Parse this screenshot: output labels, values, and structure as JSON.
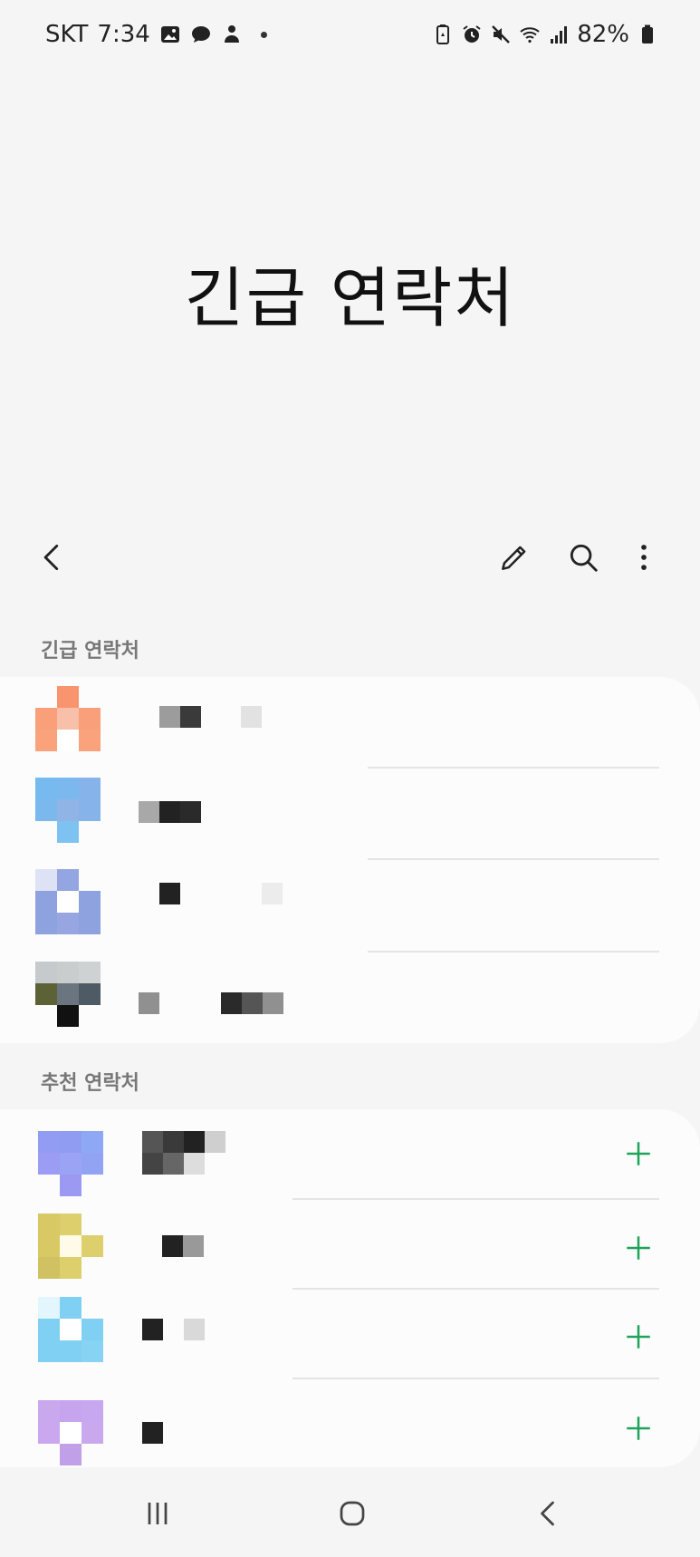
{
  "status_bar": {
    "carrier": "SKT",
    "time": "7:34",
    "battery": "82%",
    "left_icons": [
      "gallery-icon",
      "chat-bubble-icon",
      "assistant-icon"
    ],
    "right_icons": [
      "battery-saver-icon",
      "alarm-icon",
      "mute-icon",
      "wifi-icon",
      "signal-icon",
      "battery-icon"
    ]
  },
  "page": {
    "title": "긴급 연락처"
  },
  "toolbar": {
    "back_icon": "back-arrow-icon",
    "edit_icon": "pencil-icon",
    "search_icon": "search-icon",
    "more_icon": "more-vertical-icon"
  },
  "emergency": {
    "label": "긴급 연락처",
    "contacts": [
      {
        "name": "(redacted)",
        "avatar_color": "#f9a27c"
      },
      {
        "name": "(redacted)",
        "avatar_color": "#7ab8ee"
      },
      {
        "name": "(redacted)",
        "avatar_color": "#8ea2df"
      },
      {
        "name": "(redacted)",
        "avatar_color": "#4f5b64"
      }
    ]
  },
  "suggested": {
    "label": "추천 연락처",
    "contacts": [
      {
        "name": "(redacted)",
        "avatar_color": "#8f9cf2",
        "action": "add"
      },
      {
        "name": "(redacted)",
        "avatar_color": "#d9c965",
        "action": "add"
      },
      {
        "name": "(redacted)",
        "avatar_color": "#7fd0f2",
        "action": "add"
      },
      {
        "name": "(redacted)",
        "avatar_color": "#c9a8ee",
        "action": "add"
      }
    ]
  },
  "colors": {
    "background": "#f5f5f5",
    "card": "#fcfcfc",
    "accent_green": "#1fa35a",
    "label_gray": "#777777"
  },
  "navbar": {
    "recents_icon": "recents-icon",
    "home_icon": "home-icon",
    "back_icon": "nav-back-icon"
  }
}
